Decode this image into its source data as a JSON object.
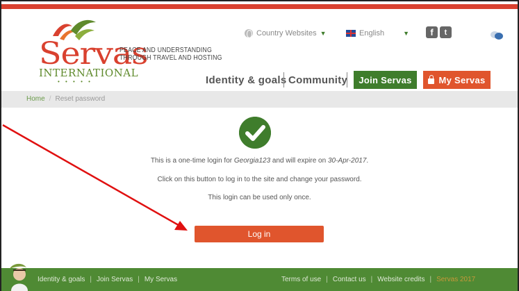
{
  "brand": {
    "name": "Servas",
    "subtitle": "INTERNATIONAL",
    "dots": "• • • • •",
    "tagline_line1": "PEACE AND UNDERSTANDING",
    "tagline_line2": "THROUGH TRAVEL AND HOSTING",
    "red": "#d9412f",
    "green": "#3f7d2c"
  },
  "utilities": {
    "country_websites": "Country Websites",
    "language": "English",
    "social_1": "f",
    "social_2": "t"
  },
  "nav": {
    "identity": "Identity & goals",
    "community": "Community",
    "join": "Join Servas",
    "my_servas": "My Servas"
  },
  "breadcrumb": {
    "home": "Home",
    "separator": "/",
    "current": "Reset password"
  },
  "main": {
    "msg1_before": "This is a one-time login for ",
    "msg1_user": "Georgia123",
    "msg1_middle": " and will expire on ",
    "msg1_date": "30-Apr-2017",
    "msg1_after": ".",
    "msg2": "Click on this button to log in to the site and change your password.",
    "msg3": "This login can be used only once.",
    "login_button": "Log in"
  },
  "footer": {
    "left_links": [
      "Identity & goals",
      "Join Servas",
      "My Servas"
    ],
    "right_links": [
      "Terms of use",
      "Contact us",
      "Website credits"
    ],
    "copyright": "Servas 2017"
  }
}
